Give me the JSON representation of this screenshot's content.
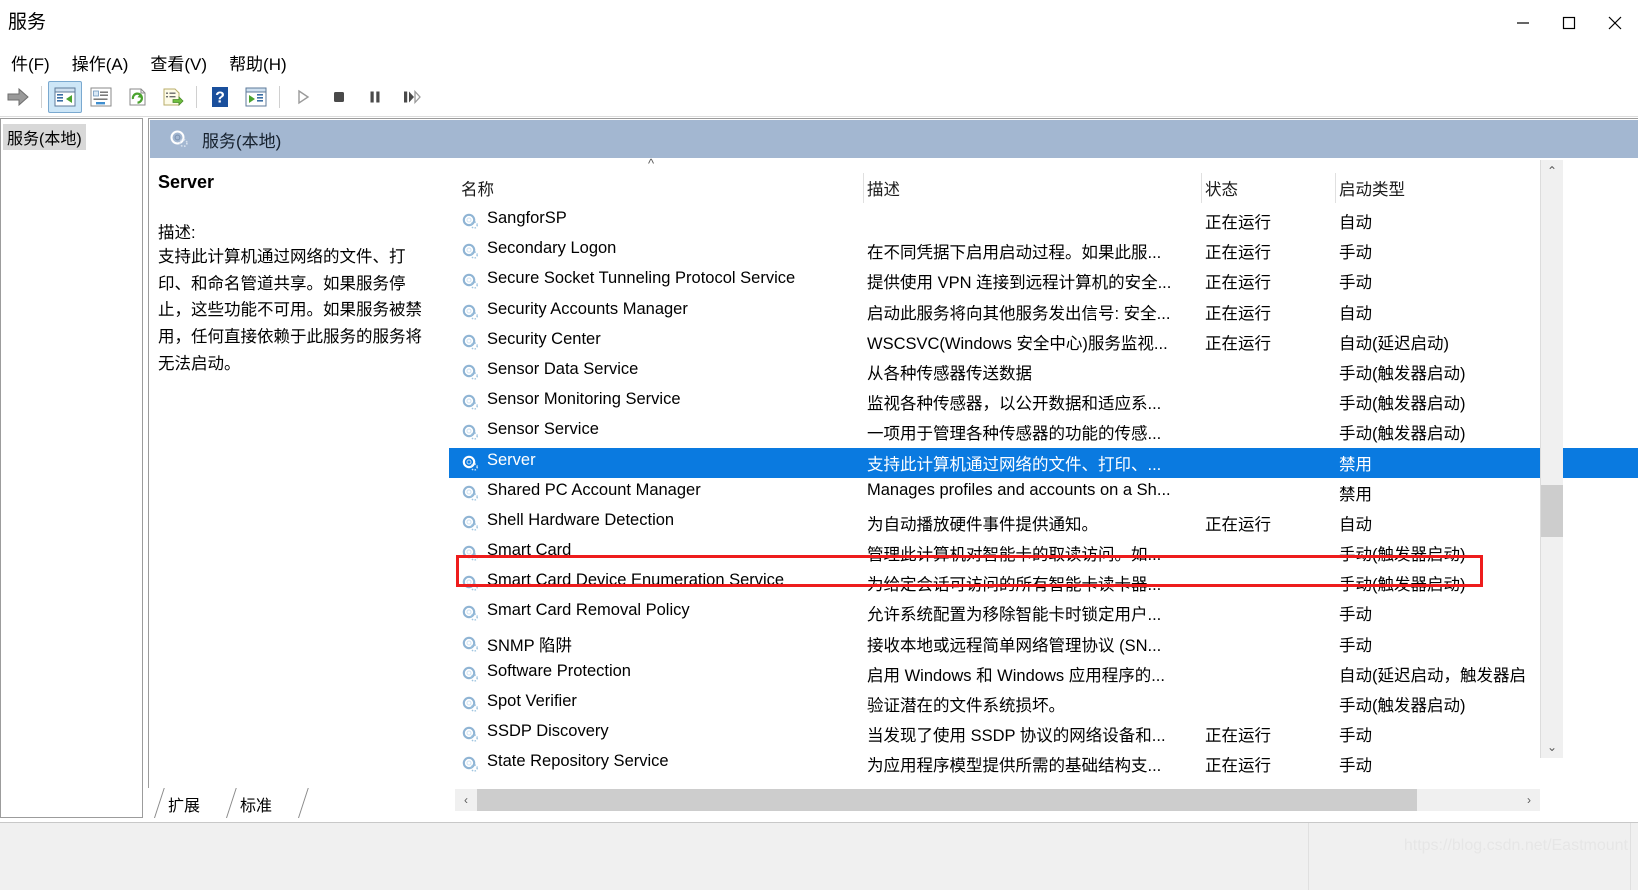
{
  "window": {
    "title": "服务",
    "controls": {
      "minimize": "—",
      "maximize": "□",
      "close": "✕"
    }
  },
  "menu": [
    {
      "label": "件(F)",
      "name": "menu-file"
    },
    {
      "label": "操作(A)",
      "name": "menu-action"
    },
    {
      "label": "查看(V)",
      "name": "menu-view"
    },
    {
      "label": "帮助(H)",
      "name": "menu-help"
    }
  ],
  "toolbar": {
    "buttons": [
      {
        "name": "forward-arrow-icon",
        "tooltip": "前进"
      },
      {
        "name": "show-hide-tree-icon",
        "tooltip": "显示/隐藏控制台树",
        "active": true
      },
      {
        "name": "properties-icon",
        "tooltip": "属性"
      },
      {
        "name": "refresh-icon",
        "tooltip": "刷新"
      },
      {
        "name": "export-list-icon",
        "tooltip": "导出列表"
      },
      {
        "name": "help-icon",
        "tooltip": "帮助"
      },
      {
        "name": "show-action-pane-icon",
        "tooltip": "显示操作窗格"
      },
      {
        "name": "start-service-icon",
        "tooltip": "启动服务"
      },
      {
        "name": "stop-service-icon",
        "tooltip": "停止服务"
      },
      {
        "name": "pause-service-icon",
        "tooltip": "暂停服务"
      },
      {
        "name": "restart-service-icon",
        "tooltip": "重启服务"
      }
    ]
  },
  "tree": {
    "root_label": "服务(本地)"
  },
  "banner": {
    "title": "服务(本地)"
  },
  "detail": {
    "service_name": "Server",
    "description_label": "描述:",
    "description": "支持此计算机通过网络的文件、打印、和命名管道共享。如果服务停止，这些功能不可用。如果服务被禁用，任何直接依赖于此服务的服务将无法启动。"
  },
  "list": {
    "sort_indicator": "^",
    "columns": [
      {
        "label": "名称",
        "name": "column-name"
      },
      {
        "label": "描述",
        "name": "column-description"
      },
      {
        "label": "状态",
        "name": "column-status"
      },
      {
        "label": "启动类型",
        "name": "column-startup-type"
      }
    ],
    "rows": [
      {
        "name": "SangforSP",
        "desc": "",
        "state": "正在运行",
        "startup": "自动",
        "selected": false
      },
      {
        "name": "Secondary Logon",
        "desc": "在不同凭据下启用启动过程。如果此服...",
        "state": "正在运行",
        "startup": "手动",
        "selected": false
      },
      {
        "name": "Secure Socket Tunneling Protocol Service",
        "desc": "提供使用 VPN 连接到远程计算机的安全...",
        "state": "正在运行",
        "startup": "手动",
        "selected": false
      },
      {
        "name": "Security Accounts Manager",
        "desc": "启动此服务将向其他服务发出信号: 安全...",
        "state": "正在运行",
        "startup": "自动",
        "selected": false
      },
      {
        "name": "Security Center",
        "desc": "WSCSVC(Windows 安全中心)服务监视...",
        "state": "正在运行",
        "startup": "自动(延迟启动)",
        "selected": false
      },
      {
        "name": "Sensor Data Service",
        "desc": "从各种传感器传送数据",
        "state": "",
        "startup": "手动(触发器启动)",
        "selected": false
      },
      {
        "name": "Sensor Monitoring Service",
        "desc": "监视各种传感器，以公开数据和适应系...",
        "state": "",
        "startup": "手动(触发器启动)",
        "selected": false
      },
      {
        "name": "Sensor Service",
        "desc": "一项用于管理各种传感器的功能的传感...",
        "state": "",
        "startup": "手动(触发器启动)",
        "selected": false
      },
      {
        "name": "Server",
        "desc": "支持此计算机通过网络的文件、打印、...",
        "state": "",
        "startup": "禁用",
        "selected": true
      },
      {
        "name": "Shared PC Account Manager",
        "desc": "Manages profiles and accounts on a Sh...",
        "state": "",
        "startup": "禁用",
        "selected": false
      },
      {
        "name": "Shell Hardware Detection",
        "desc": "为自动播放硬件事件提供通知。",
        "state": "正在运行",
        "startup": "自动",
        "selected": false
      },
      {
        "name": "Smart Card",
        "desc": "管理此计算机对智能卡的取读访问。如...",
        "state": "",
        "startup": "手动(触发器启动)",
        "selected": false
      },
      {
        "name": "Smart Card Device Enumeration Service",
        "desc": "为给定会话可访问的所有智能卡读卡器...",
        "state": "",
        "startup": "手动(触发器启动)",
        "selected": false
      },
      {
        "name": "Smart Card Removal Policy",
        "desc": "允许系统配置为移除智能卡时锁定用户...",
        "state": "",
        "startup": "手动",
        "selected": false
      },
      {
        "name": "SNMP 陷阱",
        "desc": "接收本地或远程简单网络管理协议 (SN...",
        "state": "",
        "startup": "手动",
        "selected": false
      },
      {
        "name": "Software Protection",
        "desc": "启用 Windows 和 Windows 应用程序的...",
        "state": "",
        "startup": "自动(延迟启动，触发器启",
        "selected": false
      },
      {
        "name": "Spot Verifier",
        "desc": "验证潜在的文件系统损坏。",
        "state": "",
        "startup": "手动(触发器启动)",
        "selected": false
      },
      {
        "name": "SSDP Discovery",
        "desc": "当发现了使用 SSDP 协议的网络设备和...",
        "state": "正在运行",
        "startup": "手动",
        "selected": false
      },
      {
        "name": "State Repository Service",
        "desc": "为应用程序模型提供所需的基础结构支...",
        "state": "正在运行",
        "startup": "手动",
        "selected": false
      }
    ]
  },
  "tabs": [
    {
      "label": "扩展",
      "name": "tab-extended",
      "active": false
    },
    {
      "label": "标准",
      "name": "tab-standard",
      "active": true
    }
  ],
  "scroll": {
    "up_arrow": "⌃",
    "down_arrow": "⌄",
    "left_arrow": "‹",
    "right_arrow": "›"
  },
  "watermark": "https://blog.csdn.net/Eastmount",
  "colors": {
    "selection_blue": "#0a7ae0",
    "annotation_red": "#ee1c1c",
    "banner_blue": "#a3b7d1"
  }
}
